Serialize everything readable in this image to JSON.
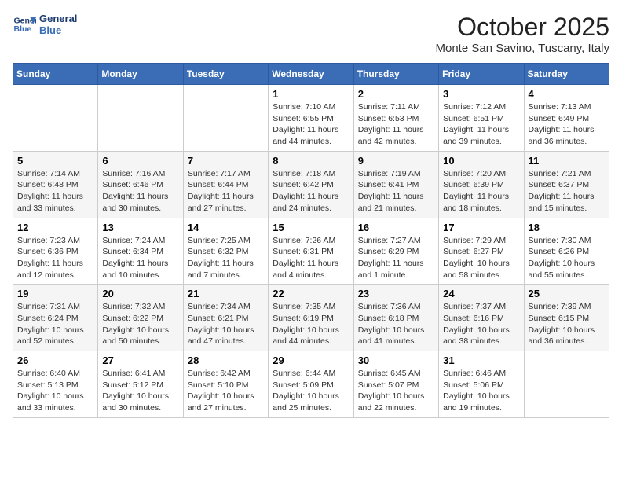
{
  "header": {
    "logo_line1": "General",
    "logo_line2": "Blue",
    "title": "October 2025",
    "subtitle": "Monte San Savino, Tuscany, Italy"
  },
  "days_of_week": [
    "Sunday",
    "Monday",
    "Tuesday",
    "Wednesday",
    "Thursday",
    "Friday",
    "Saturday"
  ],
  "weeks": [
    [
      {
        "day": "",
        "info": ""
      },
      {
        "day": "",
        "info": ""
      },
      {
        "day": "",
        "info": ""
      },
      {
        "day": "1",
        "info": "Sunrise: 7:10 AM\nSunset: 6:55 PM\nDaylight: 11 hours and 44 minutes."
      },
      {
        "day": "2",
        "info": "Sunrise: 7:11 AM\nSunset: 6:53 PM\nDaylight: 11 hours and 42 minutes."
      },
      {
        "day": "3",
        "info": "Sunrise: 7:12 AM\nSunset: 6:51 PM\nDaylight: 11 hours and 39 minutes."
      },
      {
        "day": "4",
        "info": "Sunrise: 7:13 AM\nSunset: 6:49 PM\nDaylight: 11 hours and 36 minutes."
      }
    ],
    [
      {
        "day": "5",
        "info": "Sunrise: 7:14 AM\nSunset: 6:48 PM\nDaylight: 11 hours and 33 minutes."
      },
      {
        "day": "6",
        "info": "Sunrise: 7:16 AM\nSunset: 6:46 PM\nDaylight: 11 hours and 30 minutes."
      },
      {
        "day": "7",
        "info": "Sunrise: 7:17 AM\nSunset: 6:44 PM\nDaylight: 11 hours and 27 minutes."
      },
      {
        "day": "8",
        "info": "Sunrise: 7:18 AM\nSunset: 6:42 PM\nDaylight: 11 hours and 24 minutes."
      },
      {
        "day": "9",
        "info": "Sunrise: 7:19 AM\nSunset: 6:41 PM\nDaylight: 11 hours and 21 minutes."
      },
      {
        "day": "10",
        "info": "Sunrise: 7:20 AM\nSunset: 6:39 PM\nDaylight: 11 hours and 18 minutes."
      },
      {
        "day": "11",
        "info": "Sunrise: 7:21 AM\nSunset: 6:37 PM\nDaylight: 11 hours and 15 minutes."
      }
    ],
    [
      {
        "day": "12",
        "info": "Sunrise: 7:23 AM\nSunset: 6:36 PM\nDaylight: 11 hours and 12 minutes."
      },
      {
        "day": "13",
        "info": "Sunrise: 7:24 AM\nSunset: 6:34 PM\nDaylight: 11 hours and 10 minutes."
      },
      {
        "day": "14",
        "info": "Sunrise: 7:25 AM\nSunset: 6:32 PM\nDaylight: 11 hours and 7 minutes."
      },
      {
        "day": "15",
        "info": "Sunrise: 7:26 AM\nSunset: 6:31 PM\nDaylight: 11 hours and 4 minutes."
      },
      {
        "day": "16",
        "info": "Sunrise: 7:27 AM\nSunset: 6:29 PM\nDaylight: 11 hours and 1 minute."
      },
      {
        "day": "17",
        "info": "Sunrise: 7:29 AM\nSunset: 6:27 PM\nDaylight: 10 hours and 58 minutes."
      },
      {
        "day": "18",
        "info": "Sunrise: 7:30 AM\nSunset: 6:26 PM\nDaylight: 10 hours and 55 minutes."
      }
    ],
    [
      {
        "day": "19",
        "info": "Sunrise: 7:31 AM\nSunset: 6:24 PM\nDaylight: 10 hours and 52 minutes."
      },
      {
        "day": "20",
        "info": "Sunrise: 7:32 AM\nSunset: 6:22 PM\nDaylight: 10 hours and 50 minutes."
      },
      {
        "day": "21",
        "info": "Sunrise: 7:34 AM\nSunset: 6:21 PM\nDaylight: 10 hours and 47 minutes."
      },
      {
        "day": "22",
        "info": "Sunrise: 7:35 AM\nSunset: 6:19 PM\nDaylight: 10 hours and 44 minutes."
      },
      {
        "day": "23",
        "info": "Sunrise: 7:36 AM\nSunset: 6:18 PM\nDaylight: 10 hours and 41 minutes."
      },
      {
        "day": "24",
        "info": "Sunrise: 7:37 AM\nSunset: 6:16 PM\nDaylight: 10 hours and 38 minutes."
      },
      {
        "day": "25",
        "info": "Sunrise: 7:39 AM\nSunset: 6:15 PM\nDaylight: 10 hours and 36 minutes."
      }
    ],
    [
      {
        "day": "26",
        "info": "Sunrise: 6:40 AM\nSunset: 5:13 PM\nDaylight: 10 hours and 33 minutes."
      },
      {
        "day": "27",
        "info": "Sunrise: 6:41 AM\nSunset: 5:12 PM\nDaylight: 10 hours and 30 minutes."
      },
      {
        "day": "28",
        "info": "Sunrise: 6:42 AM\nSunset: 5:10 PM\nDaylight: 10 hours and 27 minutes."
      },
      {
        "day": "29",
        "info": "Sunrise: 6:44 AM\nSunset: 5:09 PM\nDaylight: 10 hours and 25 minutes."
      },
      {
        "day": "30",
        "info": "Sunrise: 6:45 AM\nSunset: 5:07 PM\nDaylight: 10 hours and 22 minutes."
      },
      {
        "day": "31",
        "info": "Sunrise: 6:46 AM\nSunset: 5:06 PM\nDaylight: 10 hours and 19 minutes."
      },
      {
        "day": "",
        "info": ""
      }
    ]
  ]
}
